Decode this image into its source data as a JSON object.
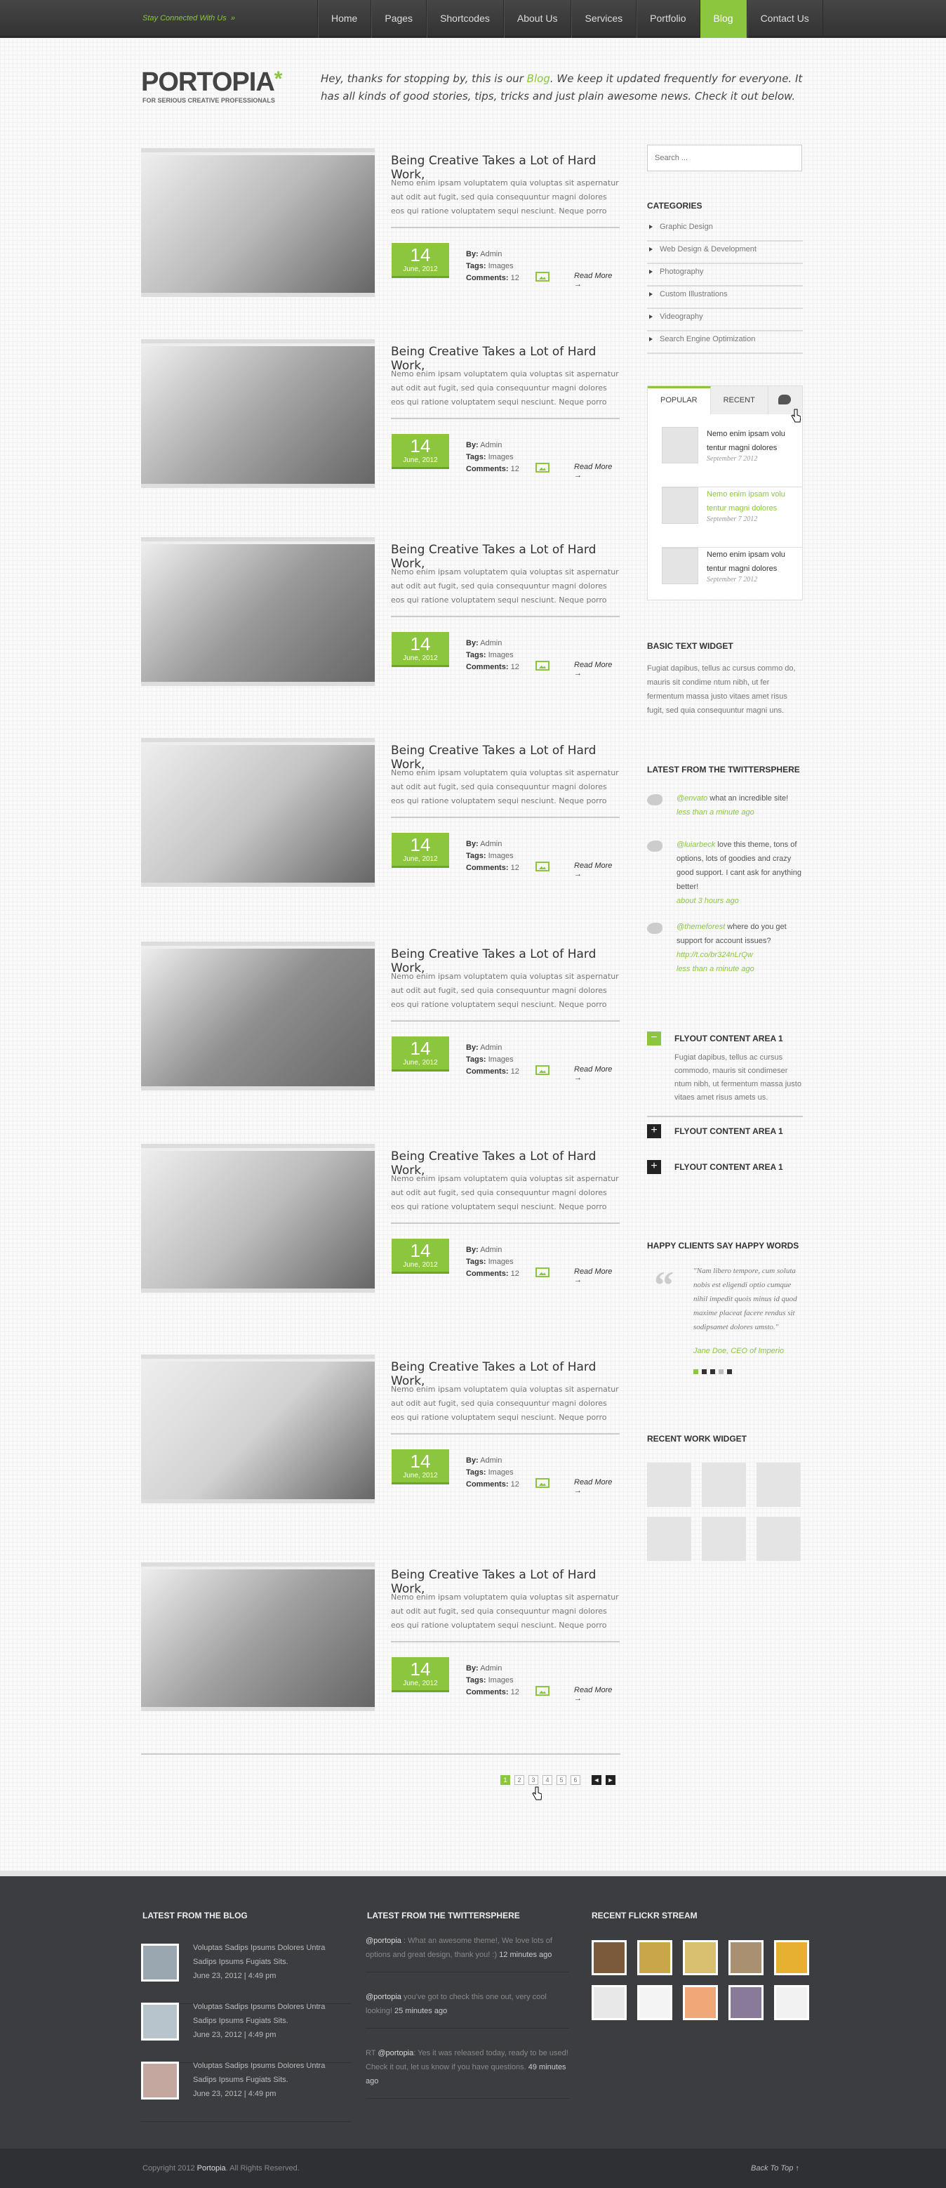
{
  "topbar": {
    "stay": "Stay Connected With Us",
    "stay_arrow": "»",
    "nav": [
      "Home",
      "Pages",
      "Shortcodes",
      "About Us",
      "Services",
      "Portfolio",
      "Blog",
      "Contact Us"
    ],
    "active": "Blog"
  },
  "header": {
    "logo": "PORTOPIA",
    "logo_star": "*",
    "tagline": "For Serious Creative Professionals",
    "intro_pre": "Hey, thanks for stopping by, this is our ",
    "intro_link": "Blog",
    "intro_post": ". We keep it updated frequently for everyone. It has all kinds of good stories, tips, tricks and just plain awesome news. Check it out below."
  },
  "posts": [
    {
      "title": "Being Creative Takes a Lot of Hard Work,",
      "excerpt": "Nemo enim ipsam voluptatem quia voluptas sit aspernatur aut odit aut fugit, sed quia consequuntur magni dolores eos qui ratione voluptatem sequi nesciunt. Neque porro",
      "day": "14",
      "month": "June, 2012",
      "by": "Admin",
      "tags": "Images",
      "comments": "12",
      "more": "Read More →",
      "img": "#b9b9b9"
    },
    {
      "title": "Being Creative Takes a Lot of Hard Work,",
      "excerpt": "Nemo enim ipsam voluptatem quia voluptas sit aspernatur aut odit aut fugit, sed quia consequuntur magni dolores eos qui ratione voluptatem sequi nesciunt. Neque porro",
      "day": "14",
      "month": "June, 2012",
      "by": "Admin",
      "tags": "Images",
      "comments": "12",
      "more": "Read More →",
      "img": "#a6a6a6"
    },
    {
      "title": "Being Creative Takes a Lot of Hard Work,",
      "excerpt": "Nemo enim ipsam voluptatem quia voluptas sit aspernatur aut odit aut fugit, sed quia consequuntur magni dolores eos qui ratione voluptatem sequi nesciunt. Neque porro",
      "day": "14",
      "month": "June, 2012",
      "by": "Admin",
      "tags": "Images",
      "comments": "12",
      "more": "Read More →",
      "img": "#9a9a9a"
    },
    {
      "title": "Being Creative Takes a Lot of Hard Work,",
      "excerpt": "Nemo enim ipsam voluptatem quia voluptas sit aspernatur aut odit aut fugit, sed quia consequuntur magni dolores eos qui ratione voluptatem sequi nesciunt. Neque porro",
      "day": "14",
      "month": "June, 2012",
      "by": "Admin",
      "tags": "Images",
      "comments": "12",
      "more": "Read More →",
      "img": "#c4c4c4"
    },
    {
      "title": "Being Creative Takes a Lot of Hard Work,",
      "excerpt": "Nemo enim ipsam voluptatem quia voluptas sit aspernatur aut odit aut fugit, sed quia consequuntur magni dolores eos qui ratione voluptatem sequi nesciunt. Neque porro",
      "day": "14",
      "month": "June, 2012",
      "by": "Admin",
      "tags": "Images",
      "comments": "12",
      "more": "Read More →",
      "img": "#8f8f8f"
    },
    {
      "title": "Being Creative Takes a Lot of Hard Work,",
      "excerpt": "Nemo enim ipsam voluptatem quia voluptas sit aspernatur aut odit aut fugit, sed quia consequuntur magni dolores eos qui ratione voluptatem sequi nesciunt. Neque porro",
      "day": "14",
      "month": "June, 2012",
      "by": "Admin",
      "tags": "Images",
      "comments": "12",
      "more": "Read More →",
      "img": "#bdbdbd"
    },
    {
      "title": "Being Creative Takes a Lot of Hard Work,",
      "excerpt": "Nemo enim ipsam voluptatem quia voluptas sit aspernatur aut odit aut fugit, sed quia consequuntur magni dolores eos qui ratione voluptatem sequi nesciunt. Neque porro",
      "day": "14",
      "month": "June, 2012",
      "by": "Admin",
      "tags": "Images",
      "comments": "12",
      "more": "Read More →",
      "img": "#d2d2d2"
    },
    {
      "title": "Being Creative Takes a Lot of Hard Work,",
      "excerpt": "Nemo enim ipsam voluptatem quia voluptas sit aspernatur aut odit aut fugit, sed quia consequuntur magni dolores eos qui ratione voluptatem sequi nesciunt. Neque porro",
      "day": "14",
      "month": "June, 2012",
      "by": "Admin",
      "tags": "Images",
      "comments": "12",
      "more": "Read More →",
      "img": "#9f9f9f"
    }
  ],
  "labels": {
    "by": "By:",
    "tags": "Tags:",
    "comments": "Comments:"
  },
  "pager": {
    "pages": [
      "1",
      "2",
      "3",
      "4",
      "5",
      "6"
    ],
    "current": "1",
    "prev": "◄",
    "next": "►"
  },
  "sidebar": {
    "search_placeholder": "Search ...",
    "categories_title": "Categories",
    "categories": [
      "Graphic Design",
      "Web Design & Development",
      "Photography",
      "Custom Illustrations",
      "Videography",
      "Search Engine Optimization"
    ],
    "tabs": [
      "Popular",
      "Recent"
    ],
    "tab_posts": [
      {
        "title": "Nemo enim ipsam volu tentur magni dolores",
        "date": "September 7 2012"
      },
      {
        "title": "Nemo enim ipsam volu tentur magni dolores",
        "date": "September 7 2012"
      },
      {
        "title": "Nemo enim ipsam volu tentur magni dolores",
        "date": "September 7 2012"
      }
    ],
    "text_widget_title": "Basic Text Widget",
    "text_widget": "Fugiat dapibus, tellus ac cursus commo do, mauris sit condime ntum nibh, ut fer fermentum massa justo vitaes amet risus fugit, sed quia consequuntur magni uns.",
    "twitter_title": "Latest From The Twittersphere",
    "tweets": [
      {
        "user": "@envato",
        "text": " what an incredible site!",
        "time": "less than a minute ago"
      },
      {
        "user": "@luiarbeck",
        "text": " love this theme, tons of options, lots of goodies and crazy good support.  I cant ask for anything better!",
        "time": "about 3 hours ago"
      },
      {
        "user": "@themeforest",
        "text": " where do you get support for account issues? ",
        "link": "http://t.co/br324nLrQw",
        "time": "less than a minute ago"
      }
    ],
    "flyouts": [
      {
        "title": "Flyout Content Area 1",
        "body": "Fugiat dapibus, tellus ac cursus commodo, mauris sit condimeser ntum nibh, ut fermentum massa justo vitaes amet risus amets us.",
        "open": true
      },
      {
        "title": "Flyout Content Area 1",
        "open": false
      },
      {
        "title": "Flyout Content Area 1",
        "open": false
      }
    ],
    "flyout_open_symbol": "−",
    "flyout_closed_symbol": "+",
    "clients_title": "Happy Clients Say Happy Words",
    "quote": "\"Nam libero tempore, cum soluta nobis est eligendi optio cumque nihil impedit quois minus id quod maxime placeat facere rendus sit sodipsamet dolores umsto.\"",
    "quote_author": "Jane Doe, CEO of Imperio",
    "recent_work_title": "Recent Work Widget"
  },
  "footer": {
    "blog_title": "Latest From The Blog",
    "blog": [
      {
        "title": "Voluptas Sadips Ipsums Dolores Untra Sadips Ipsums Fugiats Sits.",
        "date": "June 23, 2012   |   4:49 pm"
      },
      {
        "title": "Voluptas Sadips Ipsums Dolores Untra Sadips Ipsums Fugiats Sits.",
        "date": "June 23, 2012   |   4:49 pm"
      },
      {
        "title": "Voluptas Sadips Ipsums Dolores Untra Sadips Ipsums Fugiats Sits.",
        "date": "June 23, 2012   |   4:49 pm"
      }
    ],
    "twitter_title": "Latest From The Twittersphere",
    "tweets": [
      {
        "pre": "",
        "user": "@portopia",
        "text": " : What an awesome theme!, We love lots of options and great design, thank you!  :) ",
        "time": "12 minutes ago"
      },
      {
        "pre": "",
        "user": "@portopia",
        "text": " you've got to check this one out, very cool looking! ",
        "time": "25 minutes ago"
      },
      {
        "pre": "RT ",
        "user": "@portopia",
        "text": ": Yes it was released today, ready to be used! Check it out, let us know if you have questions. ",
        "time": "49 minutes ago"
      }
    ],
    "flickr_title": "Recent Flickr Stream",
    "flickr_colors": [
      "#7a5a3a",
      "#c9a64a",
      "#d8c070",
      "#a89070",
      "#e8b030",
      "#e8e8e8",
      "#f4f4f4",
      "#f0a878",
      "#8a7a9a",
      "#f2f2f2"
    ],
    "copyright_pre": "Copyright 2012 ",
    "copyright_brand": "Portopia",
    "copyright_post": ". All Rights Reserved.",
    "back_to_top": "Back To Top ↑"
  }
}
